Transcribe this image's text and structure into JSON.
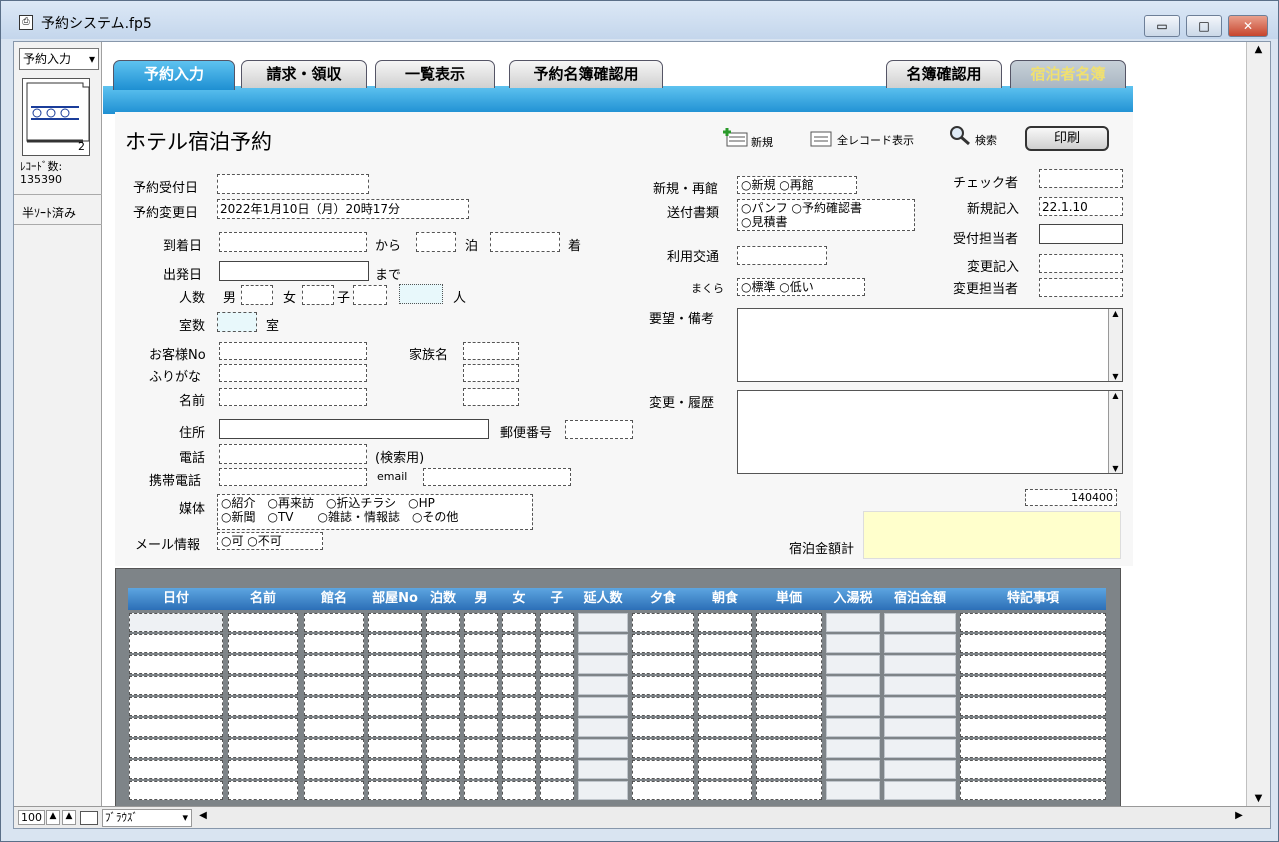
{
  "window": {
    "title": "予約システム.fp5",
    "minimize": "▭",
    "maximize": "□",
    "close": "✕"
  },
  "sidebar": {
    "layout_select": "予約入力",
    "book_number": "2",
    "record_count_label": "ﾚｺｰﾄﾞ数:",
    "record_count": "135390",
    "sort_status": "半ｿｰﾄ済み"
  },
  "tabs": [
    "予約入力",
    "請求・領収",
    "一覧表示",
    "予約名簿確認用",
    "名簿確認用",
    "宿泊者名簿"
  ],
  "toolbar": {
    "new": "新規",
    "show_all": "全レコード表示",
    "search": "検索",
    "print": "印刷"
  },
  "form": {
    "title": "ホテル宿泊予約",
    "reception_date_label": "予約受付日",
    "reception_date": "",
    "change_date_label": "予約変更日",
    "change_date": "2022年1月10日（月）20時17分",
    "arrival_label": "到着日",
    "from_label": "から",
    "nights_label": "泊",
    "arrive_label": "着",
    "departure_label": "出発日",
    "until_label": "まで",
    "people_label": "人数",
    "male_label": "男",
    "female_label": "女",
    "child_label": "子",
    "person_unit": "人",
    "rooms_label": "室数",
    "room_unit": "室",
    "customer_no_label": "お客様No",
    "furigana_label": "ふりがな",
    "name_label": "名前",
    "family_label": "家族名",
    "address_label": "住所",
    "zip_label": "郵便番号",
    "phone_label": "電話",
    "phone_note": "(検索用)",
    "mobile_label": "携帯電話",
    "email_label": "email",
    "media_label": "媒体",
    "media_row1": "○紹介　○再来訪　○折込チラシ　○HP",
    "media_row2": "○新聞　○TV　　○雑誌・情報誌　○その他",
    "mail_label": "メール情報",
    "mail_options": "○可 ○不可",
    "newvisit_label": "新規・再館",
    "newvisit_options": "○新規 ○再館",
    "send_docs_label": "送付書類",
    "send_docs_row1": "○パンフ ○予約確認書",
    "send_docs_row2": "○見積書",
    "transport_label": "利用交通",
    "pillow_label": "まくら",
    "pillow_options": "○標準 ○低い",
    "request_label": "要望・備考",
    "history_label": "変更・履歴",
    "checker_label": "チェック者",
    "new_entry_label": "新規記入",
    "new_entry": "22.1.10",
    "reception_staff_label": "受付担当者",
    "change_entry_label": "変更記入",
    "change_staff_label": "変更担当者",
    "total_number": "140400",
    "total_label": "宿泊金額計"
  },
  "table": {
    "headers": [
      "日付",
      "名前",
      "館名",
      "部屋No",
      "泊数",
      "男",
      "女",
      "子",
      "延人数",
      "夕食",
      "朝食",
      "単価",
      "入湯税",
      "宿泊金額",
      "特記事項"
    ]
  },
  "bottom": {
    "zoom": "100",
    "mode": "ﾌﾞﾗｳｽﾞ"
  }
}
